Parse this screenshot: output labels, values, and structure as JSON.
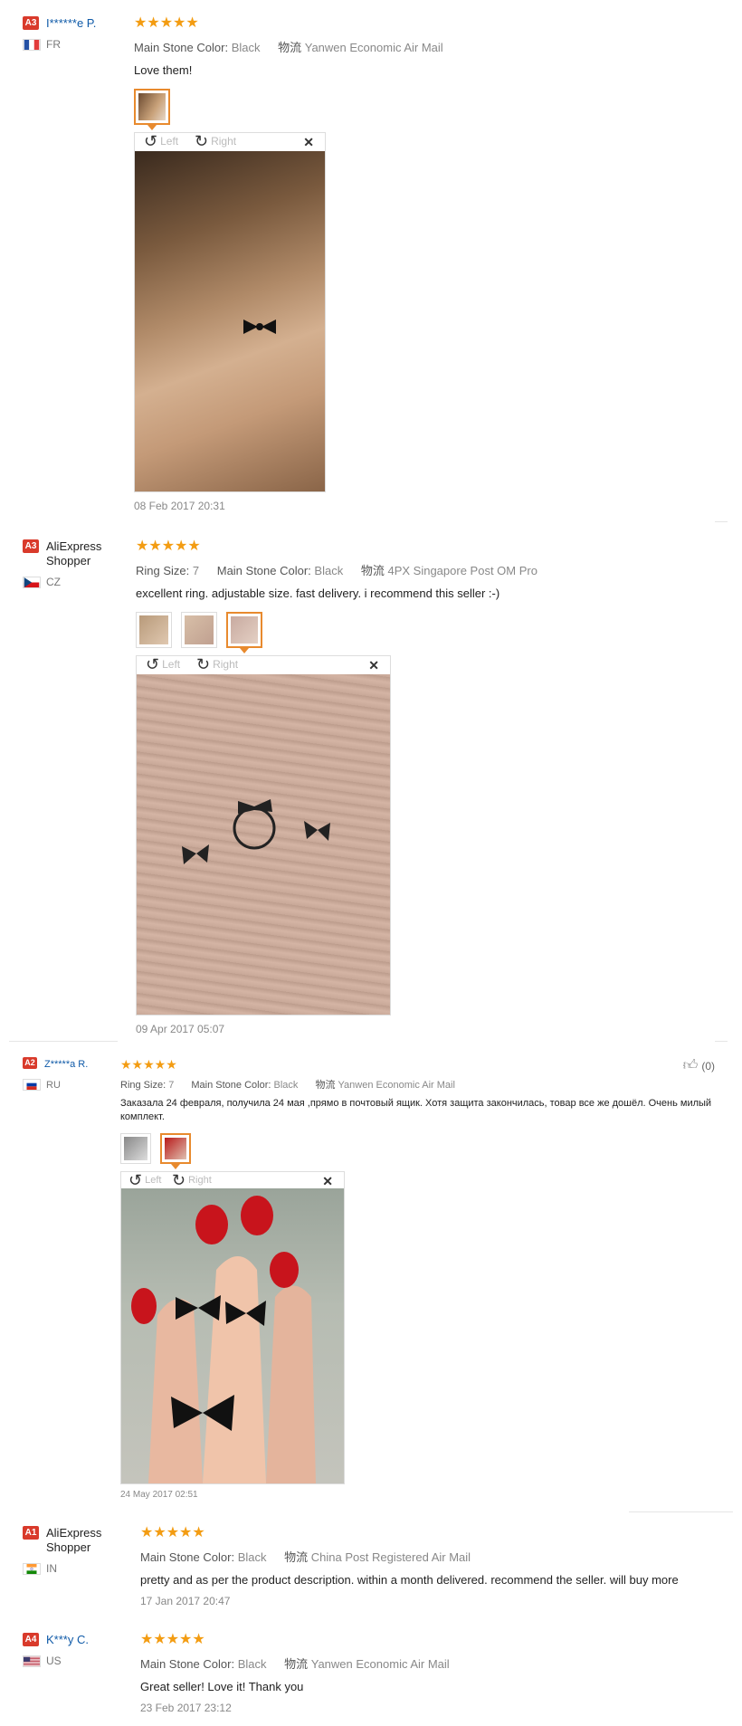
{
  "rotate": {
    "left": "Left",
    "right": "Right"
  },
  "reviews": [
    {
      "level": "A3",
      "name": "I******e P.",
      "country": "FR",
      "attrs": {
        "main_stone_label": "Main Stone Color:",
        "main_stone": "Black",
        "logistics_label": "物流",
        "logistics": "Yanwen Economic Air Mail"
      },
      "text": "Love them!",
      "date": "08 Feb 2017 20:31"
    },
    {
      "level": "A3",
      "name": "AliExpress Shopper",
      "country": "CZ",
      "attrs": {
        "ring_size_label": "Ring Size:",
        "ring_size": "7",
        "main_stone_label": "Main Stone Color:",
        "main_stone": "Black",
        "logistics_label": "物流",
        "logistics": "4PX Singapore Post OM Pro"
      },
      "text": "excellent ring. adjustable size. fast delivery. i recommend this seller :-)",
      "date": "09 Apr 2017 05:07"
    },
    {
      "level": "A2",
      "name": "Z*****a R.",
      "country": "RU",
      "likes": "(0)",
      "attrs": {
        "ring_size_label": "Ring Size:",
        "ring_size": "7",
        "main_stone_label": "Main Stone Color:",
        "main_stone": "Black",
        "logistics_label": "物流",
        "logistics": "Yanwen Economic Air Mail"
      },
      "text": "Заказала 24 февраля, получила 24 мая ,прямо в почтовый ящик. Хотя защита закончилась, товар все же дошёл. Очень милый комплект.",
      "date": "24 May 2017 02:51"
    },
    {
      "level": "A1",
      "name": "AliExpress Shopper",
      "country": "IN",
      "attrs": {
        "main_stone_label": "Main Stone Color:",
        "main_stone": "Black",
        "logistics_label": "物流",
        "logistics": "China Post Registered Air Mail"
      },
      "text": "pretty and as per the product description. within a month delivered. recommend the seller. will buy more",
      "date": "17 Jan 2017 20:47"
    },
    {
      "level": "A4",
      "name": "K***y C.",
      "country": "US",
      "attrs": {
        "main_stone_label": "Main Stone Color:",
        "main_stone": "Black",
        "logistics_label": "物流",
        "logistics": "Yanwen Economic Air Mail"
      },
      "text": "Great seller! Love it! Thank you",
      "date": "23 Feb 2017 23:12"
    }
  ],
  "colors": {
    "star": "#f39c12",
    "level_badge": "#d93a2b",
    "name_link": "#0f5aa8",
    "selected_thumb": "#e88a2e"
  }
}
